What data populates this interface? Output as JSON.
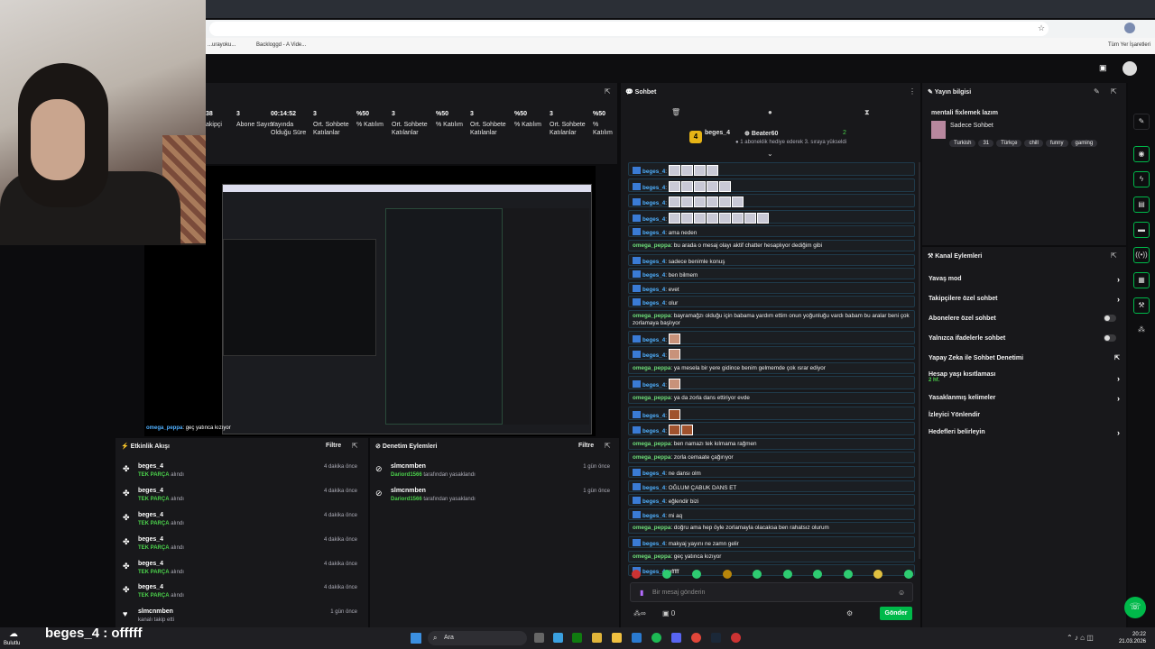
{
  "browser": {
    "bookmarks": [
      "...urayoku...",
      "Backloggd - A Vide...",
      "Tüm Yer İşaretleri"
    ]
  },
  "stats": [
    {
      "value": "38",
      "label": "akipçi"
    },
    {
      "value": "3",
      "label": "Abone Sayısı"
    },
    {
      "value": "00:14:52",
      "label": "Yayında Olduğu Süre"
    },
    {
      "value": "3",
      "label": "Ort. Sohbete Katılanlar"
    },
    {
      "value": "%50",
      "label": "% Katılım"
    },
    {
      "value": "3",
      "label": "Ort. Sohbete Katılanlar"
    },
    {
      "value": "%50",
      "label": "% Katılım"
    },
    {
      "value": "3",
      "label": "Ort. Sohbete Katılanlar"
    },
    {
      "value": "%50",
      "label": "% Katılım"
    },
    {
      "value": "3",
      "label": "Ort. Sohbete Katılanlar"
    },
    {
      "value": "%50",
      "label": "% Katılım"
    }
  ],
  "preview": {
    "caption_user": "omega_peppa",
    "caption_text": ": geç yatınca kızıyor"
  },
  "activity": {
    "title": "Etkinlik Akışı",
    "filter": "Filtre",
    "items": [
      {
        "user": "beges_4",
        "highlight": "TEK PARÇA",
        "action": "alındı",
        "time": "4 dakika önce"
      },
      {
        "user": "beges_4",
        "highlight": "TEK PARÇA",
        "action": "alındı",
        "time": "4 dakika önce"
      },
      {
        "user": "beges_4",
        "highlight": "TEK PARÇA",
        "action": "alındı",
        "time": "4 dakika önce"
      },
      {
        "user": "beges_4",
        "highlight": "TEK PARÇA",
        "action": "alındı",
        "time": "4 dakika önce"
      },
      {
        "user": "beges_4",
        "highlight": "TEK PARÇA",
        "action": "alındı",
        "time": "4 dakika önce"
      },
      {
        "user": "beges_4",
        "highlight": "TEK PARÇA",
        "action": "alındı",
        "time": "4 dakika önce"
      },
      {
        "user": "slmcnmben",
        "highlight": "",
        "action": "kanalı takip etti",
        "time": "1 gün önce"
      }
    ]
  },
  "moderation": {
    "title": "Denetim Eylemleri",
    "filter": "Filtre",
    "items": [
      {
        "user": "slmcnmben",
        "mod": "Dariord1566",
        "action": "tarafından yasaklandı",
        "time": "1 gün önce"
      },
      {
        "user": "slmcnmben",
        "mod": "Dariord1566",
        "action": "tarafından yasaklandı",
        "time": "1 gün önce"
      }
    ]
  },
  "chat": {
    "title": "Sohbet",
    "pinned_user": "beges_4",
    "pinned_count": "4",
    "gift_user": "Beater60",
    "gift_text": "1 aboneklik hediye ederek 3. sıraya yükseldi",
    "gift_count": "2",
    "messages": [
      {
        "user": "beges_4",
        "text": "",
        "emotes": 4,
        "emote": "lt"
      },
      {
        "user": "beges_4",
        "text": "",
        "emotes": 5,
        "emote": "lt"
      },
      {
        "user": "beges_4",
        "text": "",
        "emotes": 6,
        "emote": "lt"
      },
      {
        "user": "beges_4",
        "text": "",
        "emotes": 8,
        "emote": "lt"
      },
      {
        "user": "beges_4",
        "text": "ama neden"
      },
      {
        "user": "omega_peppa",
        "text": "bu arada o mesaj olayı aktif chatter hesaplıyor dediğim gibi"
      },
      {
        "user": "beges_4",
        "text": "sadece benimle konuş"
      },
      {
        "user": "beges_4",
        "text": "ben bilmem"
      },
      {
        "user": "beges_4",
        "text": "evet"
      },
      {
        "user": "beges_4",
        "text": "olur"
      },
      {
        "user": "omega_peppa",
        "text": "bayramağzı olduğu için babama yardım ettim onun yoğunluğu vardı babam bu aralar beni çok zorlamaya başlıyor"
      },
      {
        "user": "beges_4",
        "text": "",
        "emotes": 1,
        "emote": "sk"
      },
      {
        "user": "beges_4",
        "text": "",
        "emotes": 1,
        "emote": "sk"
      },
      {
        "user": "omega_peppa",
        "text": "ya mesela bir yere gidince benim gelmemde çok ısrar ediyor"
      },
      {
        "user": "beges_4",
        "text": "",
        "emotes": 1,
        "emote": "sk"
      },
      {
        "user": "omega_peppa",
        "text": "ya da zorla dans ettiriyor evde"
      },
      {
        "user": "beges_4",
        "text": "",
        "emotes": 1,
        "emote": "dk"
      },
      {
        "user": "beges_4",
        "text": "",
        "emotes": 2,
        "emote": "dk"
      },
      {
        "user": "omega_peppa",
        "text": "ben namazı tek kılmama rağmen"
      },
      {
        "user": "omega_peppa",
        "text": "zorla cemaate çağırıyor"
      },
      {
        "user": "beges_4",
        "text": "ne dansı olm"
      },
      {
        "user": "beges_4",
        "text": "OĞLUM ÇABUK DANS ET"
      },
      {
        "user": "beges_4",
        "text": "eğlendir bizi"
      },
      {
        "user": "beges_4",
        "text": "mi aq"
      },
      {
        "user": "omega_peppa",
        "text": "doğru ama hep öyle zorlamayla olacaksa ben rahatsız olurum"
      },
      {
        "user": "beges_4",
        "text": "makyaj yayını ne zamn gelir"
      },
      {
        "user": "omega_peppa",
        "text": "geç yatınca kızıyor"
      },
      {
        "user": "beges_4",
        "text": "offfff"
      }
    ],
    "input_placeholder": "Bir mesaj gönderin",
    "points": "0",
    "send": "Gönder"
  },
  "stream_info": {
    "title": "Yayın bilgisi",
    "stream_title": "mentali fixlemek lazım",
    "category": "Sadece Sohbet",
    "tags": [
      "Turkish",
      "31",
      "Türkçe",
      "chill",
      "funny",
      "gaming"
    ]
  },
  "channel_actions": {
    "title": "Kanal Eylemleri",
    "items": [
      {
        "label": "Yavaş mod",
        "control": "chevron"
      },
      {
        "label": "Takipçilere özel sohbet",
        "control": "chevron"
      },
      {
        "label": "Abonelere özel sohbet",
        "control": "toggle"
      },
      {
        "label": "Yalnızca ifadelerle sohbet",
        "control": "toggle"
      },
      {
        "label": "Yapay Zeka ile Sohbet Denetimi",
        "control": "external"
      },
      {
        "label": "Hesap yaşı kısıtlaması",
        "sub": "2 hf.",
        "control": "chevron"
      },
      {
        "label": "Yasaklanmış kelimeler",
        "control": "chevron"
      },
      {
        "label": "İzleyici Yönlendir",
        "control": "none"
      },
      {
        "label": "Hedefleri belirleyin",
        "control": "chevron"
      }
    ]
  },
  "overlay": {
    "text": "beges_4 : offfff",
    "weather": "Bulutlu"
  },
  "taskbar": {
    "search": "Ara",
    "time": "20:22",
    "date": "21.03.2026"
  },
  "colors": {
    "accent_green": "#00b94a",
    "bg": "#0c0c0e",
    "panel": "#18181b"
  }
}
